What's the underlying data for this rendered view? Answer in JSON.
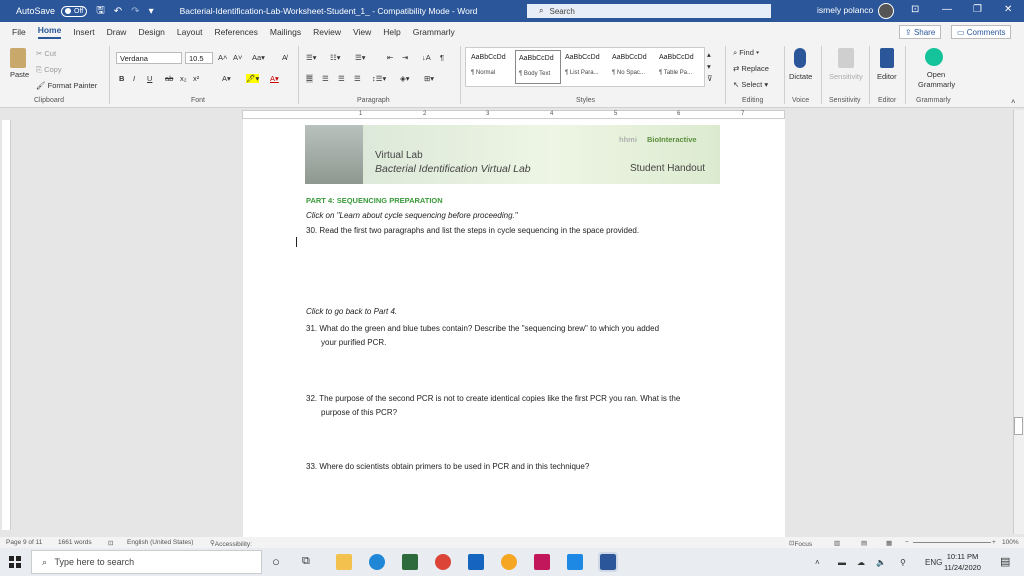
{
  "titlebar": {
    "autosave_label": "AutoSave",
    "autosave_state": "Off",
    "doc_title": "Bacterial-Identification-Lab-Worksheet-Student_1_  -  Compatibility Mode  -  Word",
    "search_placeholder": "Search",
    "user": "ismely polanco",
    "controls": [
      "⊡",
      "—",
      "❐",
      "✕"
    ]
  },
  "menu": {
    "tabs": [
      "File",
      "Home",
      "Insert",
      "Draw",
      "Design",
      "Layout",
      "References",
      "Mailings",
      "Review",
      "View",
      "Help",
      "Grammarly"
    ],
    "share": "Share",
    "comments": "Comments"
  },
  "ribbon": {
    "clipboard": {
      "paste": "Paste",
      "cut": "Cut",
      "copy": "Copy",
      "format_painter": "Format Painter",
      "label": "Clipboard"
    },
    "font": {
      "name": "Verdana",
      "size": "10.5",
      "label": "Font"
    },
    "paragraph": {
      "label": "Paragraph"
    },
    "styles": {
      "items": [
        {
          "preview": "AaBbCcDd",
          "name": "¶ Normal"
        },
        {
          "preview": "AaBbCcDd",
          "name": "¶ Body Text"
        },
        {
          "preview": "AaBbCcDd",
          "name": "¶ List Para..."
        },
        {
          "preview": "AaBbCcDd",
          "name": "¶ No Spac..."
        },
        {
          "preview": "AaBbCcDd",
          "name": "¶ Table Pa..."
        }
      ],
      "label": "Styles"
    },
    "editing": {
      "find": "Find",
      "replace": "Replace",
      "select": "Select",
      "label": "Editing"
    },
    "voice": {
      "dictate": "Dictate",
      "label": "Voice"
    },
    "sensitivity": {
      "button": "Sensitivity",
      "label": "Sensitivity"
    },
    "editor": {
      "button": "Editor",
      "label": "Editor"
    },
    "grammarly": {
      "button": "Open Grammarly",
      "label": "Grammarly"
    }
  },
  "document": {
    "banner": {
      "virtual_lab": "Virtual Lab",
      "title": "Bacterial Identification Virtual Lab",
      "hhmi": "hhmi",
      "biointeractive": "BioInteractive",
      "handout": "Student Handout"
    },
    "part_heading": "PART 4: SEQUENCING PREPARATION",
    "instruction1": "Click on \"Learn about cycle sequencing before proceeding.\"",
    "q30": "30. Read the first two paragraphs and list the steps in cycle sequencing in the space provided.",
    "instruction2": "Click to go back to Part 4.",
    "q31_line1": "31. What do the green and blue tubes contain? Describe the \"sequencing brew\" to which you added",
    "q31_line2": "your purified PCR.",
    "q32_line1": "32. The purpose of the second PCR is not to create identical copies like the first PCR you ran. What is the",
    "q32_line2": "purpose of this PCR?",
    "q33": "33. Where do scientists obtain primers to be used in PCR and in this technique?"
  },
  "statusbar": {
    "page": "Page 9 of 11",
    "words": "1661 words",
    "language": "English (United States)",
    "accessibility": "Accessibility: Unavailable",
    "focus": "Focus",
    "zoom": "100%"
  },
  "taskbar": {
    "search_placeholder": "Type here to search",
    "language": "ENG",
    "time": "10:11 PM",
    "date": "11/24/2020"
  },
  "colors": {
    "word_blue": "#2b579a",
    "heading_green": "#3a9a3a"
  }
}
